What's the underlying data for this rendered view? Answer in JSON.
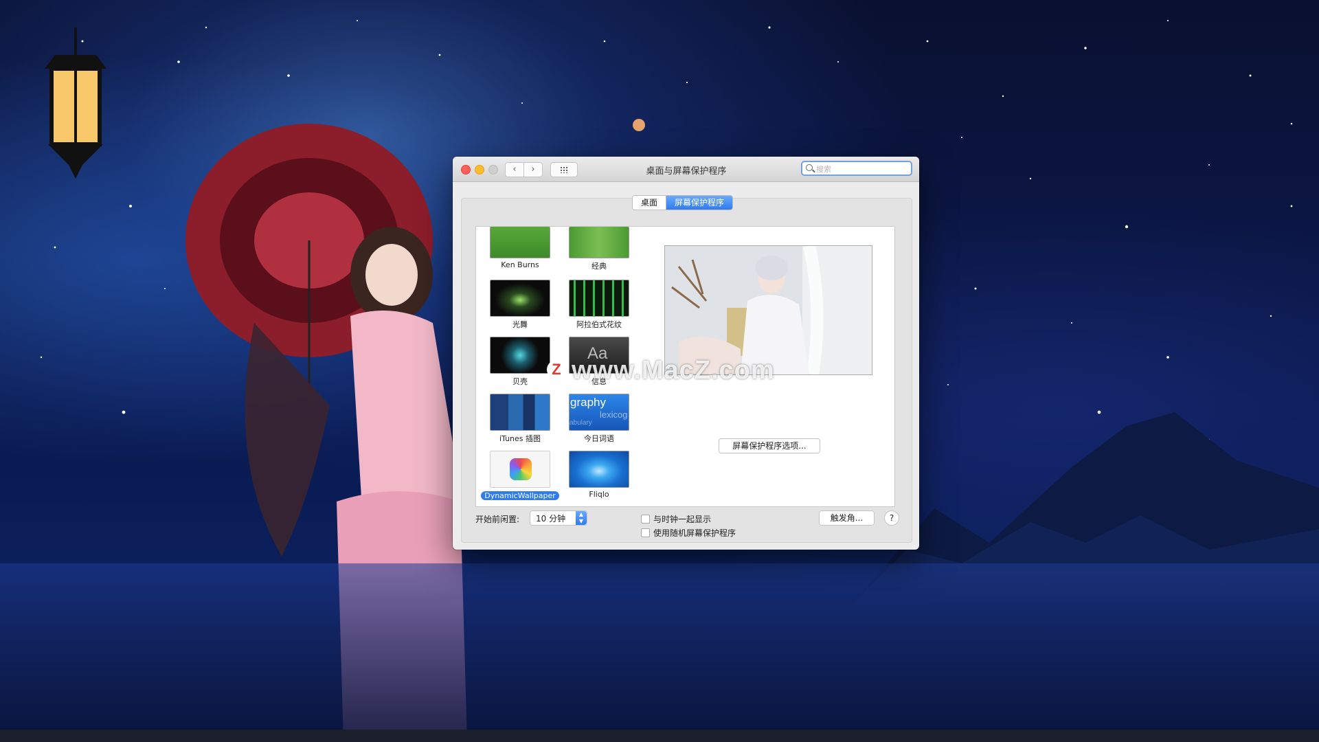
{
  "window": {
    "title": "桌面与屏幕保护程序",
    "search_placeholder": "搜索"
  },
  "tabs": [
    {
      "label": "桌面",
      "selected": false
    },
    {
      "label": "屏幕保护程序",
      "selected": true
    }
  ],
  "screensavers": [
    {
      "label": "Ken Burns",
      "selected": false
    },
    {
      "label": "经典",
      "selected": false
    },
    {
      "label": "光舞",
      "selected": false
    },
    {
      "label": "阿拉伯式花纹",
      "selected": false
    },
    {
      "label": "贝壳",
      "selected": false
    },
    {
      "label": "信息",
      "selected": false
    },
    {
      "label": "iTunes 插图",
      "selected": false
    },
    {
      "label": "今日词语",
      "selected": false
    },
    {
      "label": "DynamicWallpaper",
      "selected": true
    },
    {
      "label": "Fliqlo",
      "selected": false
    }
  ],
  "thumb_text": {
    "message": "Aa",
    "word_of_day": "graphy",
    "word_of_day_2": "lexicog",
    "word_of_day_3": "abulary"
  },
  "preview": {
    "options_button": "屏幕保护程序选项..."
  },
  "footer": {
    "idle_label": "开始前闲置:",
    "idle_value": "10 分钟",
    "show_clock_label": "与时钟一起显示",
    "show_clock_checked": false,
    "random_label": "使用随机屏幕保护程序",
    "random_checked": false,
    "hot_corners_button": "触发角...",
    "help_button": "?"
  },
  "watermark": {
    "logo": "Z",
    "text": "www.MacZ.com"
  }
}
